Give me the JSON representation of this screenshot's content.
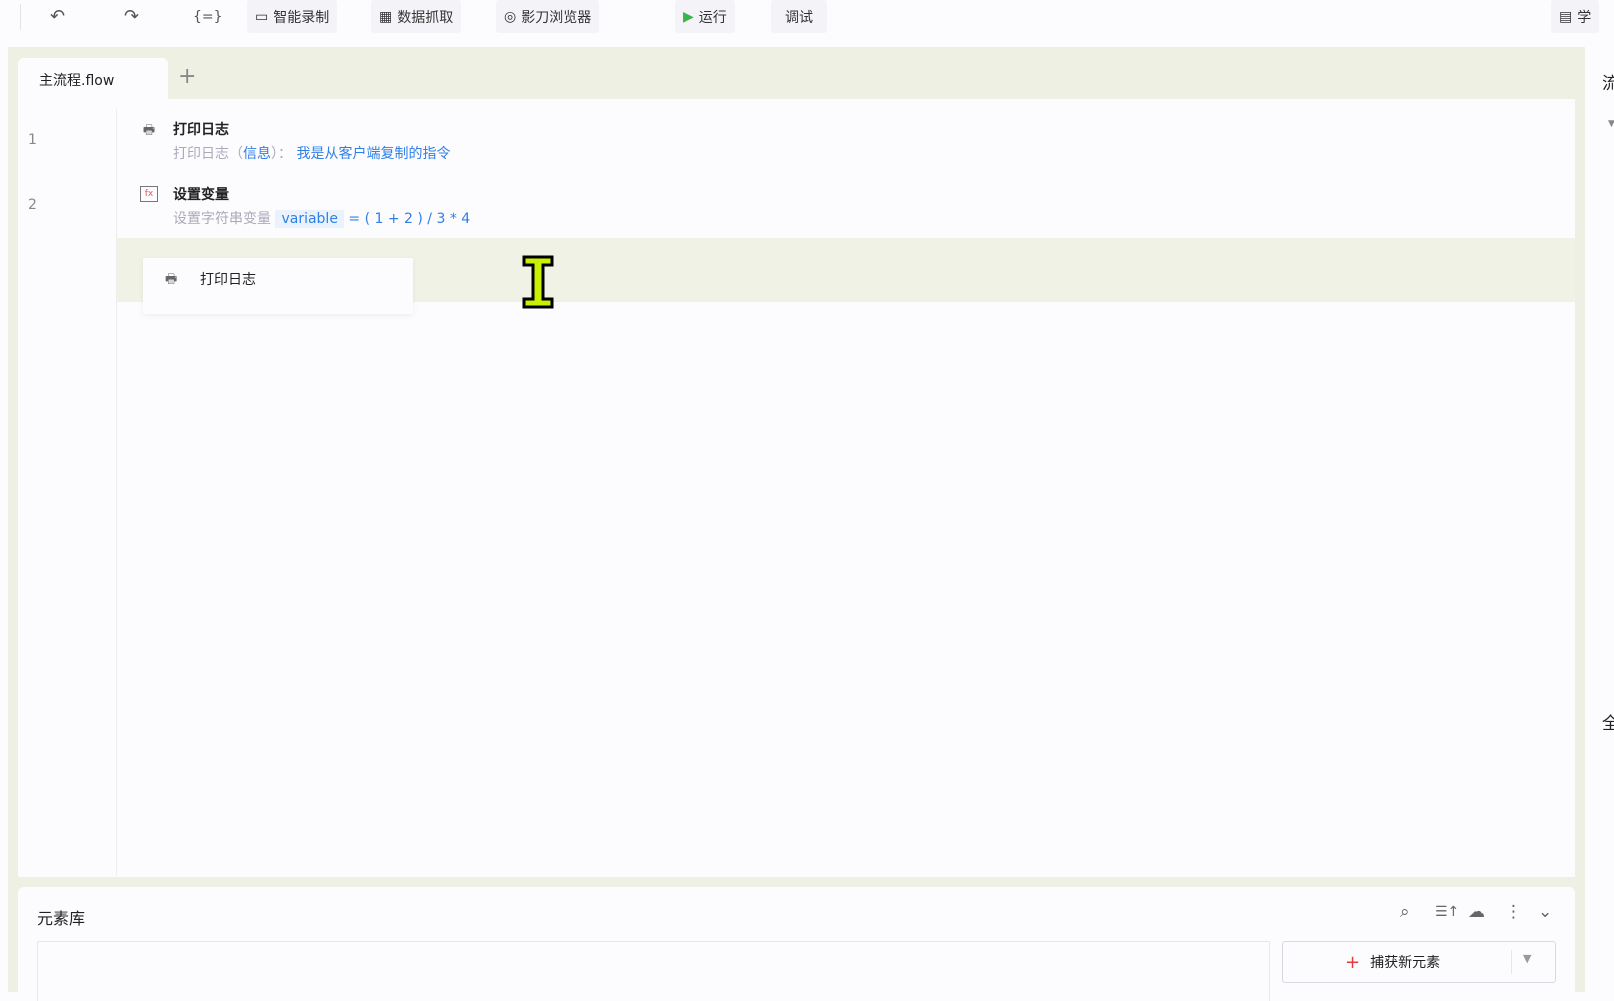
{
  "toolbar": {
    "undo_icon": "undo-icon",
    "redo_icon": "redo-icon",
    "variables_icon": "{=}",
    "record_label": "智能录制",
    "scrape_label": "数据抓取",
    "browser_label": "影刀浏览器",
    "run_label": "运行",
    "debug_label": "调试",
    "learn_label": "学"
  },
  "tabs": [
    {
      "label": "主流程.flow"
    }
  ],
  "tab_add": "+",
  "editor": {
    "lines": [
      {
        "num": "1",
        "title": "打印日志",
        "prefix": "打印日志（",
        "param": "信息",
        "mid": "）：",
        "value": "我是从客户端复制的指令"
      },
      {
        "num": "2",
        "title": "设置变量",
        "prefix": "设置字符串变量",
        "variable": "variable",
        "expr": "= ( 1 + 2 ) / 3 * 4"
      }
    ],
    "drag_card": {
      "label": "打印日志"
    }
  },
  "element_library": {
    "title": "元素库",
    "capture_label": "捕获新元素",
    "capture_plus": "+"
  },
  "right_panel": {
    "top_char": "流",
    "bottom_char": "全"
  },
  "colors": {
    "accent": "#2e7fe6",
    "run": "#3bb54a",
    "capture_plus": "#e83a3a"
  }
}
